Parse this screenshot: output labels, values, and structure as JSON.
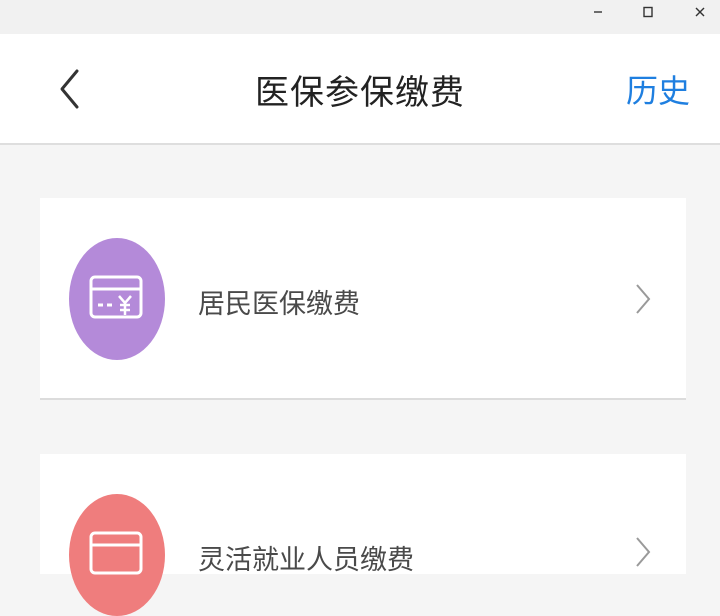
{
  "window": {
    "minimize_icon": "minimize-icon",
    "maximize_icon": "maximize-icon",
    "close_icon": "close-icon"
  },
  "header": {
    "back_icon": "chevron-left-icon",
    "title": "医保参保缴费",
    "history_label": "历史"
  },
  "items": [
    {
      "label": "居民医保缴费",
      "icon": "card-yuan-icon",
      "icon_color": "#b48ad9"
    },
    {
      "label": "灵活就业人员缴费",
      "icon": "card-icon",
      "icon_color": "#ef7d7d"
    }
  ],
  "colors": {
    "accent": "#1f7fe0",
    "background": "#f5f5f5"
  }
}
